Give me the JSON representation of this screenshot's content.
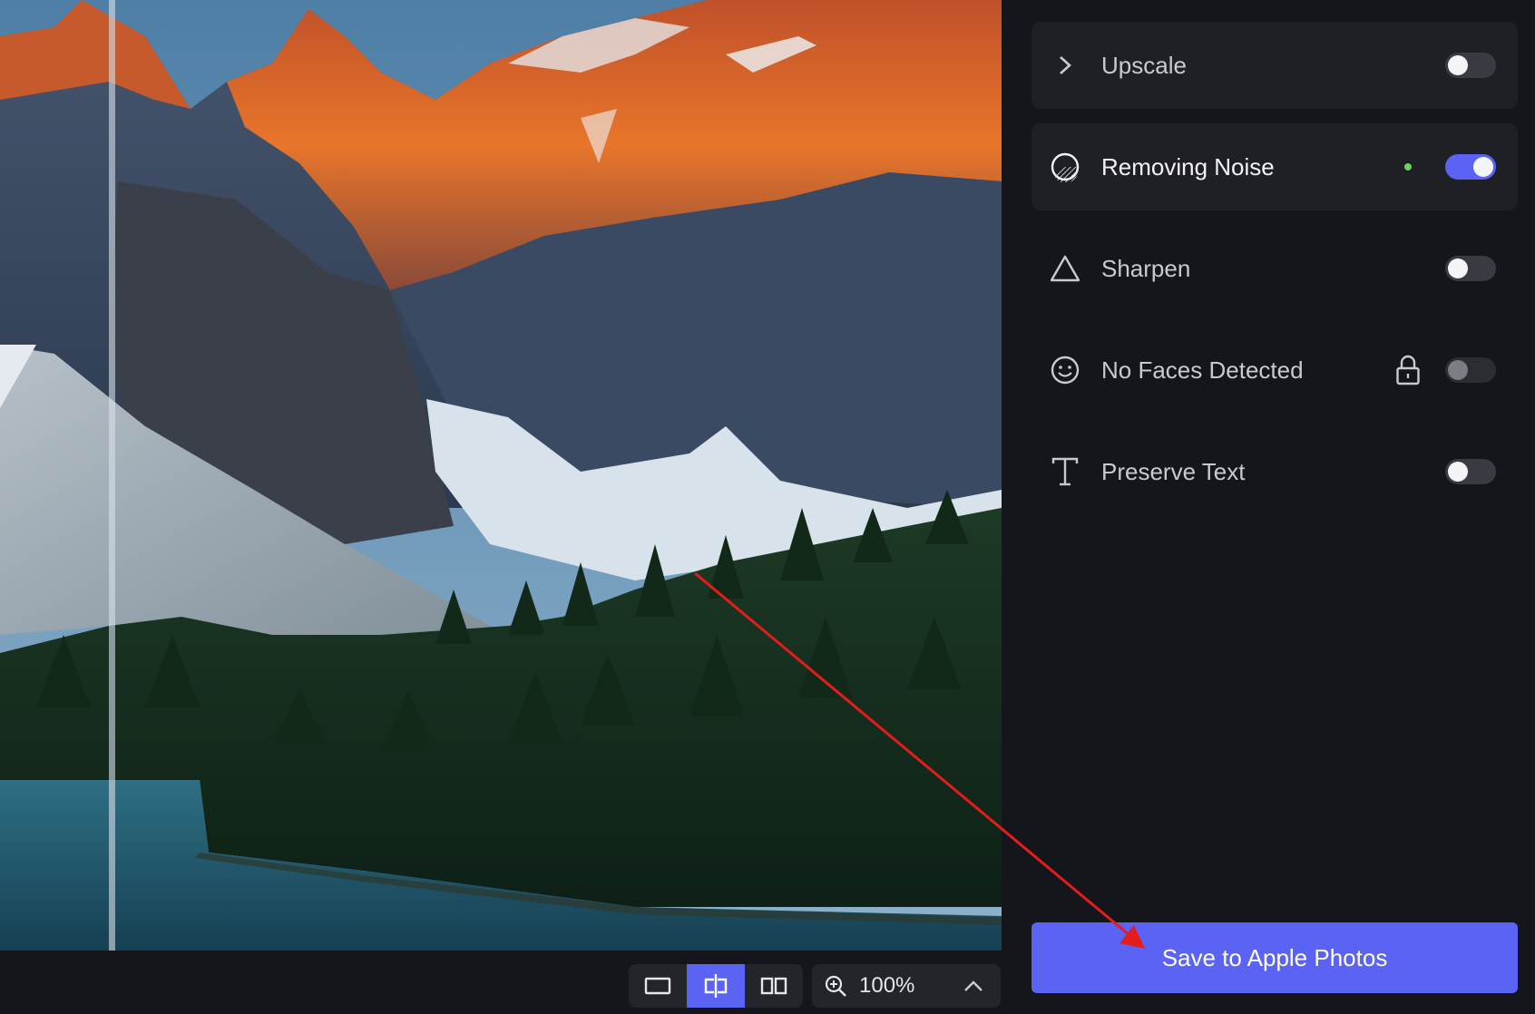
{
  "colors": {
    "accent": "#5b63f5",
    "panel_bg": "#15161b",
    "card_bg": "#1f2026",
    "status_dot": "#6ad15b",
    "annotation_arrow": "#e51c1c"
  },
  "features": [
    {
      "label": "Upscale",
      "icon": "chevron-right-icon",
      "enabled": false
    },
    {
      "label": "Removing Noise",
      "icon": "noise-icon",
      "enabled": true
    },
    {
      "label": "Sharpen",
      "icon": "triangle-icon",
      "enabled": false
    },
    {
      "label": "No Faces Detected",
      "icon": "smiley-face-icon",
      "enabled": false,
      "locked": true
    },
    {
      "label": "Preserve Text",
      "icon": "text-t-icon",
      "enabled": false
    }
  ],
  "save_button": {
    "label": "Save to Apple Photos"
  },
  "view_modes": {
    "options": [
      "single-view",
      "split-view",
      "side-by-side-view"
    ],
    "active": "split-view"
  },
  "zoom": {
    "value": "100%"
  }
}
